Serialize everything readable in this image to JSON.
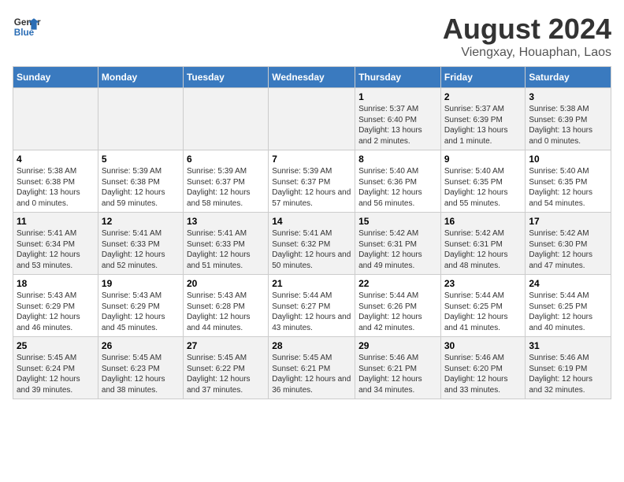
{
  "header": {
    "logo_line1": "General",
    "logo_line2": "Blue",
    "main_title": "August 2024",
    "subtitle": "Viengxay, Houaphan, Laos"
  },
  "days_of_week": [
    "Sunday",
    "Monday",
    "Tuesday",
    "Wednesday",
    "Thursday",
    "Friday",
    "Saturday"
  ],
  "weeks": [
    [
      {
        "day": "",
        "info": ""
      },
      {
        "day": "",
        "info": ""
      },
      {
        "day": "",
        "info": ""
      },
      {
        "day": "",
        "info": ""
      },
      {
        "day": "1",
        "info": "Sunrise: 5:37 AM\nSunset: 6:40 PM\nDaylight: 13 hours and 2 minutes."
      },
      {
        "day": "2",
        "info": "Sunrise: 5:37 AM\nSunset: 6:39 PM\nDaylight: 13 hours and 1 minute."
      },
      {
        "day": "3",
        "info": "Sunrise: 5:38 AM\nSunset: 6:39 PM\nDaylight: 13 hours and 0 minutes."
      }
    ],
    [
      {
        "day": "4",
        "info": "Sunrise: 5:38 AM\nSunset: 6:38 PM\nDaylight: 13 hours and 0 minutes."
      },
      {
        "day": "5",
        "info": "Sunrise: 5:39 AM\nSunset: 6:38 PM\nDaylight: 12 hours and 59 minutes."
      },
      {
        "day": "6",
        "info": "Sunrise: 5:39 AM\nSunset: 6:37 PM\nDaylight: 12 hours and 58 minutes."
      },
      {
        "day": "7",
        "info": "Sunrise: 5:39 AM\nSunset: 6:37 PM\nDaylight: 12 hours and 57 minutes."
      },
      {
        "day": "8",
        "info": "Sunrise: 5:40 AM\nSunset: 6:36 PM\nDaylight: 12 hours and 56 minutes."
      },
      {
        "day": "9",
        "info": "Sunrise: 5:40 AM\nSunset: 6:35 PM\nDaylight: 12 hours and 55 minutes."
      },
      {
        "day": "10",
        "info": "Sunrise: 5:40 AM\nSunset: 6:35 PM\nDaylight: 12 hours and 54 minutes."
      }
    ],
    [
      {
        "day": "11",
        "info": "Sunrise: 5:41 AM\nSunset: 6:34 PM\nDaylight: 12 hours and 53 minutes."
      },
      {
        "day": "12",
        "info": "Sunrise: 5:41 AM\nSunset: 6:33 PM\nDaylight: 12 hours and 52 minutes."
      },
      {
        "day": "13",
        "info": "Sunrise: 5:41 AM\nSunset: 6:33 PM\nDaylight: 12 hours and 51 minutes."
      },
      {
        "day": "14",
        "info": "Sunrise: 5:41 AM\nSunset: 6:32 PM\nDaylight: 12 hours and 50 minutes."
      },
      {
        "day": "15",
        "info": "Sunrise: 5:42 AM\nSunset: 6:31 PM\nDaylight: 12 hours and 49 minutes."
      },
      {
        "day": "16",
        "info": "Sunrise: 5:42 AM\nSunset: 6:31 PM\nDaylight: 12 hours and 48 minutes."
      },
      {
        "day": "17",
        "info": "Sunrise: 5:42 AM\nSunset: 6:30 PM\nDaylight: 12 hours and 47 minutes."
      }
    ],
    [
      {
        "day": "18",
        "info": "Sunrise: 5:43 AM\nSunset: 6:29 PM\nDaylight: 12 hours and 46 minutes."
      },
      {
        "day": "19",
        "info": "Sunrise: 5:43 AM\nSunset: 6:29 PM\nDaylight: 12 hours and 45 minutes."
      },
      {
        "day": "20",
        "info": "Sunrise: 5:43 AM\nSunset: 6:28 PM\nDaylight: 12 hours and 44 minutes."
      },
      {
        "day": "21",
        "info": "Sunrise: 5:44 AM\nSunset: 6:27 PM\nDaylight: 12 hours and 43 minutes."
      },
      {
        "day": "22",
        "info": "Sunrise: 5:44 AM\nSunset: 6:26 PM\nDaylight: 12 hours and 42 minutes."
      },
      {
        "day": "23",
        "info": "Sunrise: 5:44 AM\nSunset: 6:25 PM\nDaylight: 12 hours and 41 minutes."
      },
      {
        "day": "24",
        "info": "Sunrise: 5:44 AM\nSunset: 6:25 PM\nDaylight: 12 hours and 40 minutes."
      }
    ],
    [
      {
        "day": "25",
        "info": "Sunrise: 5:45 AM\nSunset: 6:24 PM\nDaylight: 12 hours and 39 minutes."
      },
      {
        "day": "26",
        "info": "Sunrise: 5:45 AM\nSunset: 6:23 PM\nDaylight: 12 hours and 38 minutes."
      },
      {
        "day": "27",
        "info": "Sunrise: 5:45 AM\nSunset: 6:22 PM\nDaylight: 12 hours and 37 minutes."
      },
      {
        "day": "28",
        "info": "Sunrise: 5:45 AM\nSunset: 6:21 PM\nDaylight: 12 hours and 36 minutes."
      },
      {
        "day": "29",
        "info": "Sunrise: 5:46 AM\nSunset: 6:21 PM\nDaylight: 12 hours and 34 minutes."
      },
      {
        "day": "30",
        "info": "Sunrise: 5:46 AM\nSunset: 6:20 PM\nDaylight: 12 hours and 33 minutes."
      },
      {
        "day": "31",
        "info": "Sunrise: 5:46 AM\nSunset: 6:19 PM\nDaylight: 12 hours and 32 minutes."
      }
    ]
  ]
}
